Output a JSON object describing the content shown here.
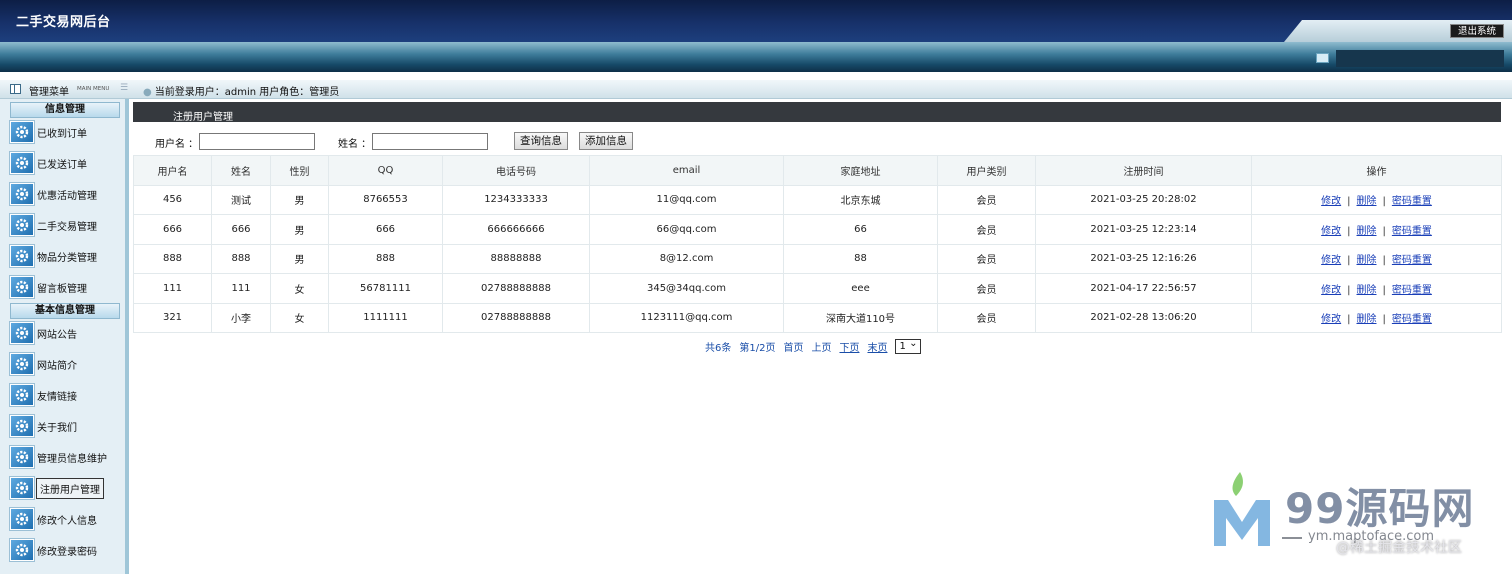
{
  "header": {
    "app_title": "二手交易网后台",
    "logout_label": "退出系统"
  },
  "infobar": {
    "menu_title": "管理菜单",
    "menu_subtitle": "MAIN MENU",
    "user_info": "当前登录用户：admin  用户角色：管理员"
  },
  "sidebar": {
    "section1_title": "信息管理",
    "section1_items": [
      "已收到订单",
      "已发送订单",
      "优惠活动管理",
      "二手交易管理",
      "物品分类管理",
      "留言板管理"
    ],
    "section2_title": "基本信息管理",
    "section2_items": [
      "网站公告",
      "网站简介",
      "友情链接",
      "关于我们",
      "管理员信息维护",
      "注册用户管理",
      "修改个人信息",
      "修改登录密码"
    ],
    "active_item": "注册用户管理"
  },
  "main": {
    "title": "注册用户管理",
    "search": {
      "username_label": "用户名 ：",
      "username_value": "",
      "name_label": "姓名 ：",
      "name_value": "",
      "query_button": "查询信息",
      "add_button": "添加信息"
    },
    "table": {
      "columns": [
        "用户名",
        "姓名",
        "性别",
        "QQ",
        "电话号码",
        "email",
        "家庭地址",
        "用户类别",
        "注册时间",
        "操作"
      ],
      "rows": [
        [
          "456",
          "测试",
          "男",
          "8766553",
          "1234333333",
          "11@qq.com",
          "北京东城",
          "会员",
          "2021-03-25 20:28:02"
        ],
        [
          "666",
          "666",
          "男",
          "666",
          "666666666",
          "66@qq.com",
          "66",
          "会员",
          "2021-03-25 12:23:14"
        ],
        [
          "888",
          "888",
          "男",
          "888",
          "88888888",
          "8@12.com",
          "88",
          "会员",
          "2021-03-25 12:16:26"
        ],
        [
          "111",
          "111",
          "女",
          "56781111",
          "02788888888",
          "345@34qq.com",
          "eee",
          "会员",
          "2021-04-17 22:56:57"
        ],
        [
          "321",
          "小李",
          "女",
          "1111111",
          "02788888888",
          "1123111@qq.com",
          "深南大道110号",
          "会员",
          "2021-02-28 13:06:20"
        ]
      ],
      "actions": [
        "修改",
        "删除",
        "密码重置"
      ]
    },
    "pager": {
      "total": "共6条",
      "page": "第1/2页",
      "first": "首页",
      "prev": "上页",
      "next": "下页",
      "last": "末页",
      "select_value": "1"
    }
  },
  "watermark": {
    "brand": "99源码网",
    "url": "ym.maptoface.com",
    "credit": "@稀土掘金技术社区"
  }
}
